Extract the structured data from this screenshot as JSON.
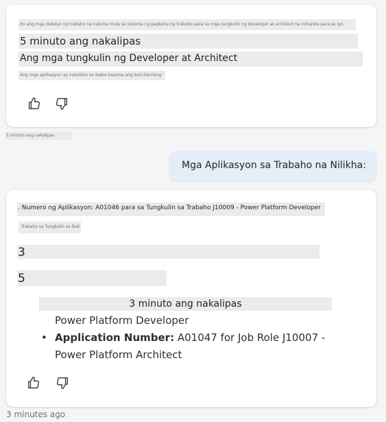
{
  "card1": {
    "faint_line": "Ito ang mga detalye ng trabaho na nakuha mula sa sistema ng pagkuha ng trabaho para sa mga tungkulin ng developer at architect na inihanda para sa iyo.",
    "time_ago": "5 minuto ang nakalipas",
    "roles": "Ang mga tungkulin ng Developer at Architect",
    "faint_line_2": "Ang mga aplikasyon ay nakalista sa ibaba kasama ang kani-kanilang Trabaho Tungkulin.",
    "like_icon": "thumbs-up-icon",
    "dislike_icon": "thumbs-down-icon"
  },
  "card1_timestamp": "5 minuto ang nakalipas",
  "user_message": "Mga Aplikasyon sa Trabaho na Nilikha:",
  "card2": {
    "app_line": ". Numero ng Aplikasyon: A01046 para sa Tungkulin sa Trabaho J10009 - Power Platform Developer",
    "faint_sub": "Trabaho sa Tungkulin sa ibaba",
    "number_a": "3",
    "number_b": "5",
    "time_ago": "3 minuto ang nakalipas",
    "continued_line": "Power Platform Developer",
    "bullets": [
      {
        "label": "Application Number:",
        "text": " A01047 for Job Role J10007 -",
        "text2": "Power Platform Architect"
      }
    ],
    "like_icon": "thumbs-up-icon",
    "dislike_icon": "thumbs-down-icon"
  },
  "footer_timestamp": "3 minutes ago"
}
